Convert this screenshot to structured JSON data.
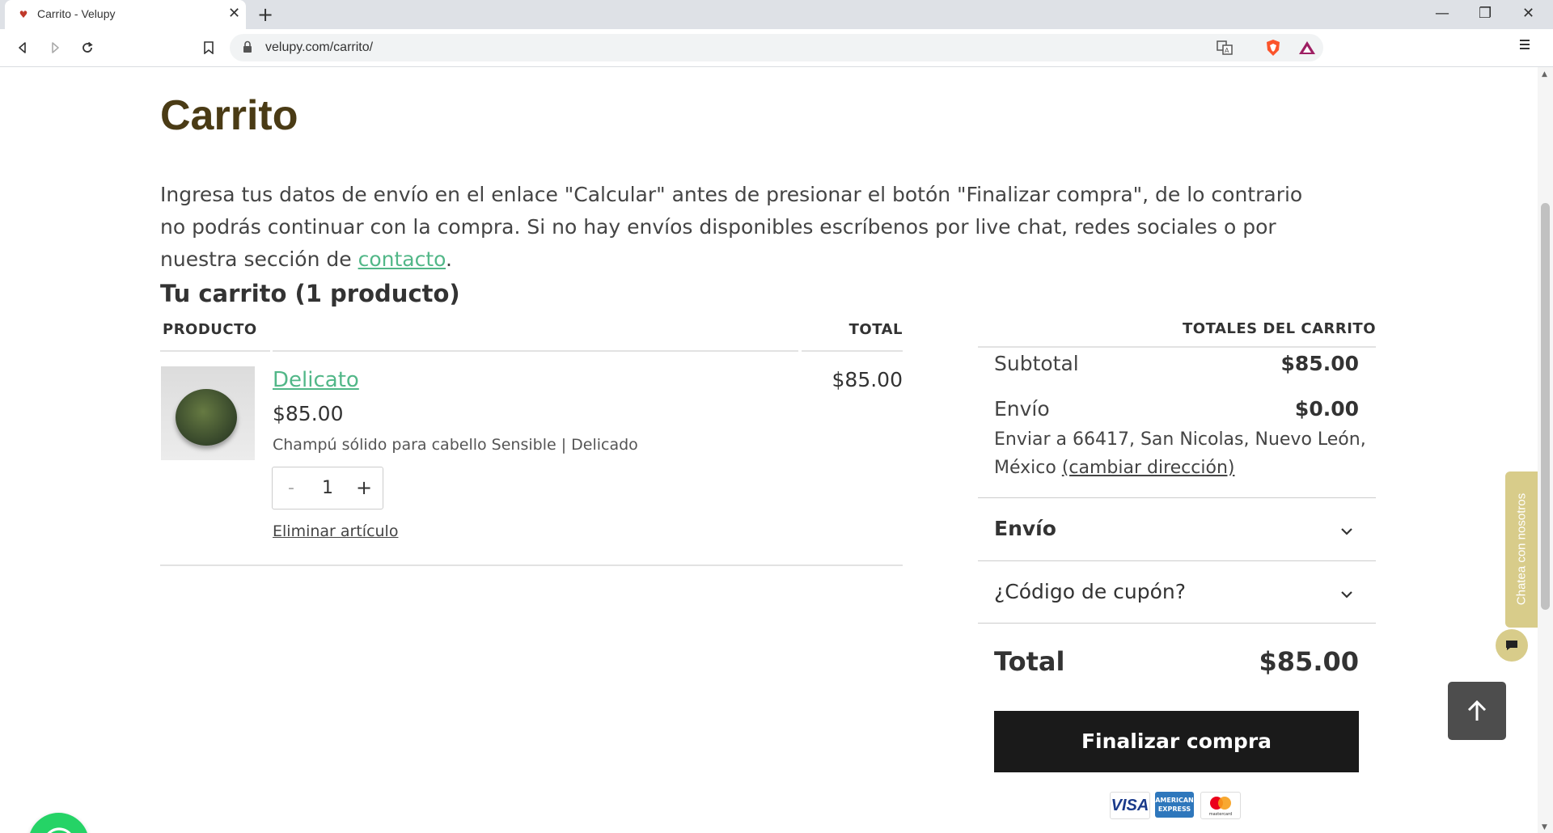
{
  "browser": {
    "tab_title": "Carrito - Velupy",
    "url": "velupy.com/carrito/",
    "icons": [
      "back-icon",
      "forward-icon",
      "reload-icon",
      "bookmark-icon",
      "lock-icon",
      "translate-icon",
      "brave-shield-icon",
      "brave-rewards-icon",
      "menu-icon",
      "minimize-icon",
      "maximize-icon",
      "close-icon"
    ]
  },
  "page": {
    "title": "Carrito",
    "notice_text": "Ingresa tus datos de envío en el enlace \"Calcular\" antes de presionar el botón \"Finalizar compra\", de lo contrario no podrás continuar con la compra. Si no hay envíos disponibles escríbenos por live chat, redes sociales o por nuestra sección de ",
    "notice_link": "contacto",
    "notice_end": "."
  },
  "cart": {
    "heading": "Tu carrito (1 producto)",
    "col_product": "PRODUCTO",
    "col_total": "TOTAL",
    "items": [
      {
        "name": "Delicato",
        "price": "$85.00",
        "description": "Champú sólido para cabello Sensible | Delicado",
        "quantity": "1",
        "minus": "-",
        "plus": "+",
        "remove_label": "Eliminar artículo",
        "line_total": "$85.00"
      }
    ]
  },
  "totals": {
    "heading": "TOTALES DEL CARRITO",
    "subtotal_label": "Subtotal",
    "subtotal_value": "$85.00",
    "shipping_label": "Envío",
    "shipping_value": "$0.00",
    "ship_to": "Enviar a 66417, San Nicolas, Nuevo León, México ",
    "change_address": "(cambiar dirección)",
    "shipping_accordion": "Envío",
    "coupon_accordion": "¿Código de cupón?",
    "total_label": "Total",
    "total_value": "$85.00",
    "checkout_button": "Finalizar compra",
    "payment_methods": [
      "VISA",
      "AMERICAN EXPRESS",
      "mastercard"
    ]
  },
  "widgets": {
    "chat_tab": "Chatea con nosotros"
  },
  "colors": {
    "title": "#4a3b15",
    "link": "#52b788",
    "checkout_bg": "#1a1a1a",
    "chat_tab": "#d8cc8a",
    "whatsapp": "#25d366"
  }
}
